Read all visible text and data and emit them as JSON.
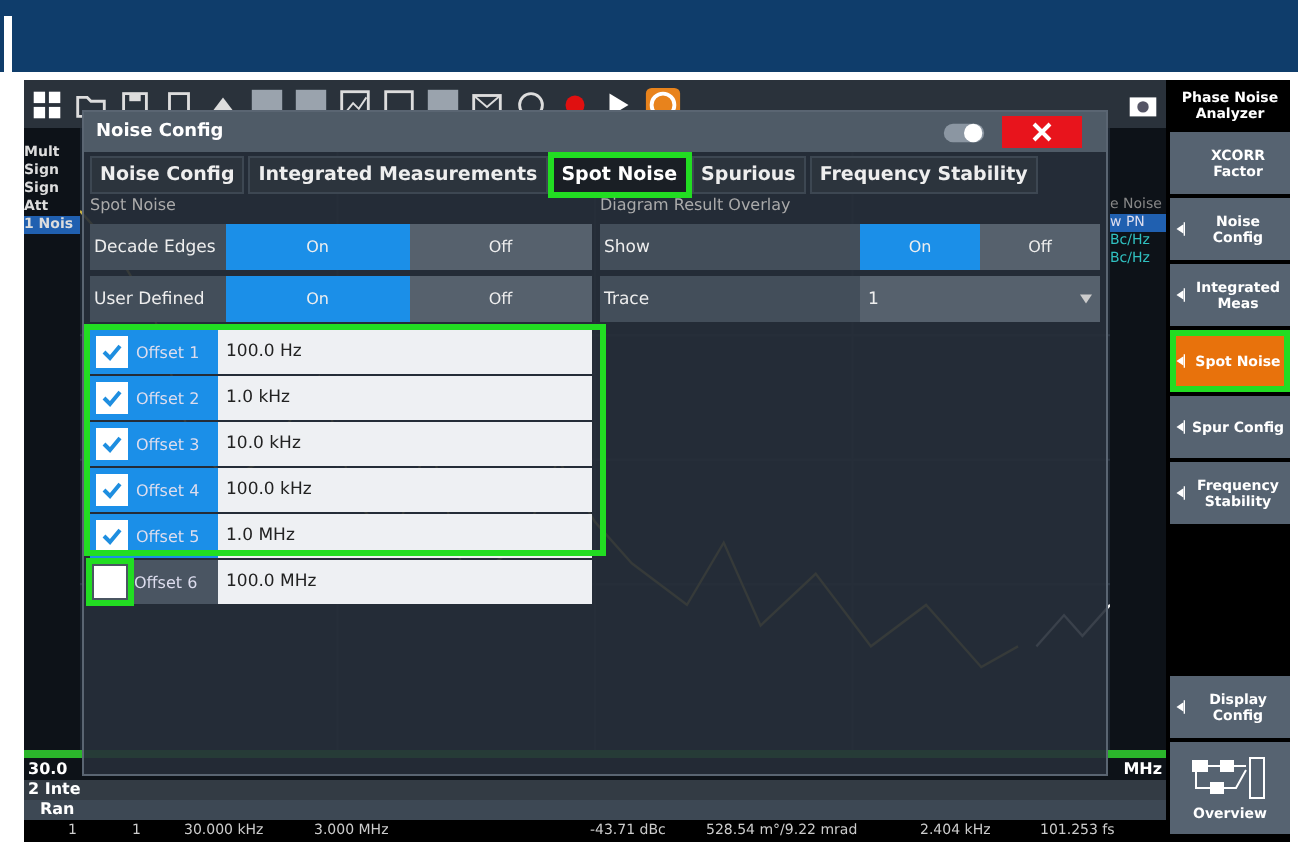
{
  "left_labels": [
    {
      "text": "Mult",
      "selected": false
    },
    {
      "text": "Sign",
      "selected": false
    },
    {
      "text": "Sign",
      "selected": false
    },
    {
      "text": "Att",
      "selected": false
    },
    {
      "text": "1 Nois",
      "selected": true
    }
  ],
  "right_labels": [
    {
      "text": "e Noise",
      "selected": false
    },
    {
      "text": "w PN",
      "selected": true
    },
    {
      "text": "Bc/Hz",
      "selected": false
    },
    {
      "text": "Bc/Hz",
      "selected": false
    }
  ],
  "dialog": {
    "title": "Noise Config",
    "tabs": [
      {
        "label": "Noise Config",
        "selected": false,
        "highlighted": false
      },
      {
        "label": "Integrated Measurements",
        "selected": false,
        "highlighted": false
      },
      {
        "label": "Spot Noise",
        "selected": true,
        "highlighted": true
      },
      {
        "label": "Spurious",
        "selected": false,
        "highlighted": false
      },
      {
        "label": "Frequency Stability",
        "selected": false,
        "highlighted": false
      }
    ],
    "spot_noise": {
      "heading": "Spot Noise",
      "switches": [
        {
          "label": "Decade Edges",
          "on_label": "On",
          "off_label": "Off",
          "on": true
        },
        {
          "label": "User Defined",
          "on_label": "On",
          "off_label": "Off",
          "on": true
        }
      ],
      "offsets": [
        {
          "label": "Offset 1",
          "value": "100.0 Hz",
          "checked": true,
          "row_highlighted": true,
          "checkbox_highlighted": false
        },
        {
          "label": "Offset 2",
          "value": "1.0 kHz",
          "checked": true,
          "row_highlighted": true,
          "checkbox_highlighted": false
        },
        {
          "label": "Offset 3",
          "value": "10.0 kHz",
          "checked": true,
          "row_highlighted": true,
          "checkbox_highlighted": false
        },
        {
          "label": "Offset 4",
          "value": "100.0 kHz",
          "checked": true,
          "row_highlighted": true,
          "checkbox_highlighted": false
        },
        {
          "label": "Offset 5",
          "value": "1.0 MHz",
          "checked": true,
          "row_highlighted": true,
          "checkbox_highlighted": false
        },
        {
          "label": "Offset 6",
          "value": "100.0 MHz",
          "checked": false,
          "row_highlighted": false,
          "checkbox_highlighted": true
        }
      ]
    },
    "overlay": {
      "heading": "Diagram Result Overlay",
      "show": {
        "label": "Show",
        "on_label": "On",
        "off_label": "Off",
        "on": true
      },
      "trace": {
        "label": "Trace",
        "value": "1"
      }
    }
  },
  "bottom": {
    "start": "30.0",
    "stop": "MHz",
    "section": "2 Inte",
    "column_1": "Ran",
    "row": [
      "1",
      "1",
      "30.000 kHz",
      "3.000 MHz",
      "-43.71 dBc",
      "528.54 m°/9.22 mrad",
      "2.404 kHz",
      "101.253 fs"
    ]
  },
  "softkeys": {
    "title": "Phase Noise Analyzer",
    "keys": [
      {
        "label": "XCORR Factor",
        "submenu": false,
        "selected": false,
        "highlighted": false
      },
      {
        "label": "Noise Config",
        "submenu": true,
        "selected": false,
        "highlighted": false
      },
      {
        "label": "Integrated Meas",
        "submenu": true,
        "selected": false,
        "highlighted": false
      },
      {
        "label": "Spot Noise",
        "submenu": true,
        "selected": true,
        "highlighted": true
      },
      {
        "label": "Spur Config",
        "submenu": true,
        "selected": false,
        "highlighted": false
      },
      {
        "label": "Frequency Stability",
        "submenu": true,
        "selected": false,
        "highlighted": false
      }
    ],
    "lower_keys": [
      {
        "label": "Display Config",
        "kind": "submenu"
      },
      {
        "label": "Overview",
        "kind": "overview"
      }
    ]
  }
}
